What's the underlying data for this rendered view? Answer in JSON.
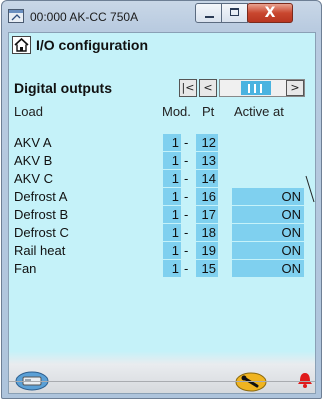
{
  "window": {
    "title": "00:000 AK-CC 750A",
    "close_glyph": "X"
  },
  "header": {
    "title": "I/O configuration"
  },
  "section": {
    "title": "Digital outputs",
    "nav_first": "|<",
    "nav_prev": "<",
    "nav_next": ">"
  },
  "columns": {
    "load": "Load",
    "mod": "Mod.",
    "pt": "Pt",
    "active": "Active at"
  },
  "rows": [
    {
      "load": "AKV A",
      "mod": "1",
      "pt": "12",
      "active": ""
    },
    {
      "load": "AKV B",
      "mod": "1",
      "pt": "13",
      "active": ""
    },
    {
      "load": "AKV C",
      "mod": "1",
      "pt": "14",
      "active": ""
    },
    {
      "load": "Defrost A",
      "mod": "1",
      "pt": "16",
      "active": "ON"
    },
    {
      "load": "Defrost B",
      "mod": "1",
      "pt": "17",
      "active": "ON"
    },
    {
      "load": "Defrost C",
      "mod": "1",
      "pt": "18",
      "active": "ON"
    },
    {
      "load": "Rail heat",
      "mod": "1",
      "pt": "19",
      "active": "ON"
    },
    {
      "load": "Fan",
      "mod": "1",
      "pt": "15",
      "active": "ON"
    }
  ],
  "separator": "-",
  "icons": {
    "app": "app-window-icon",
    "home": "home-icon",
    "left_footer": "controller-device-icon",
    "right_footer": "service-tool-icon",
    "alarm": "alarm-bell-icon"
  },
  "colors": {
    "panel_bg": "#c5f2f9",
    "cell_bg": "#7fd0ef",
    "scroll_thumb": "#4ab3e0",
    "alarm": "#e01b1b",
    "tool_badge": "#f0b420"
  }
}
